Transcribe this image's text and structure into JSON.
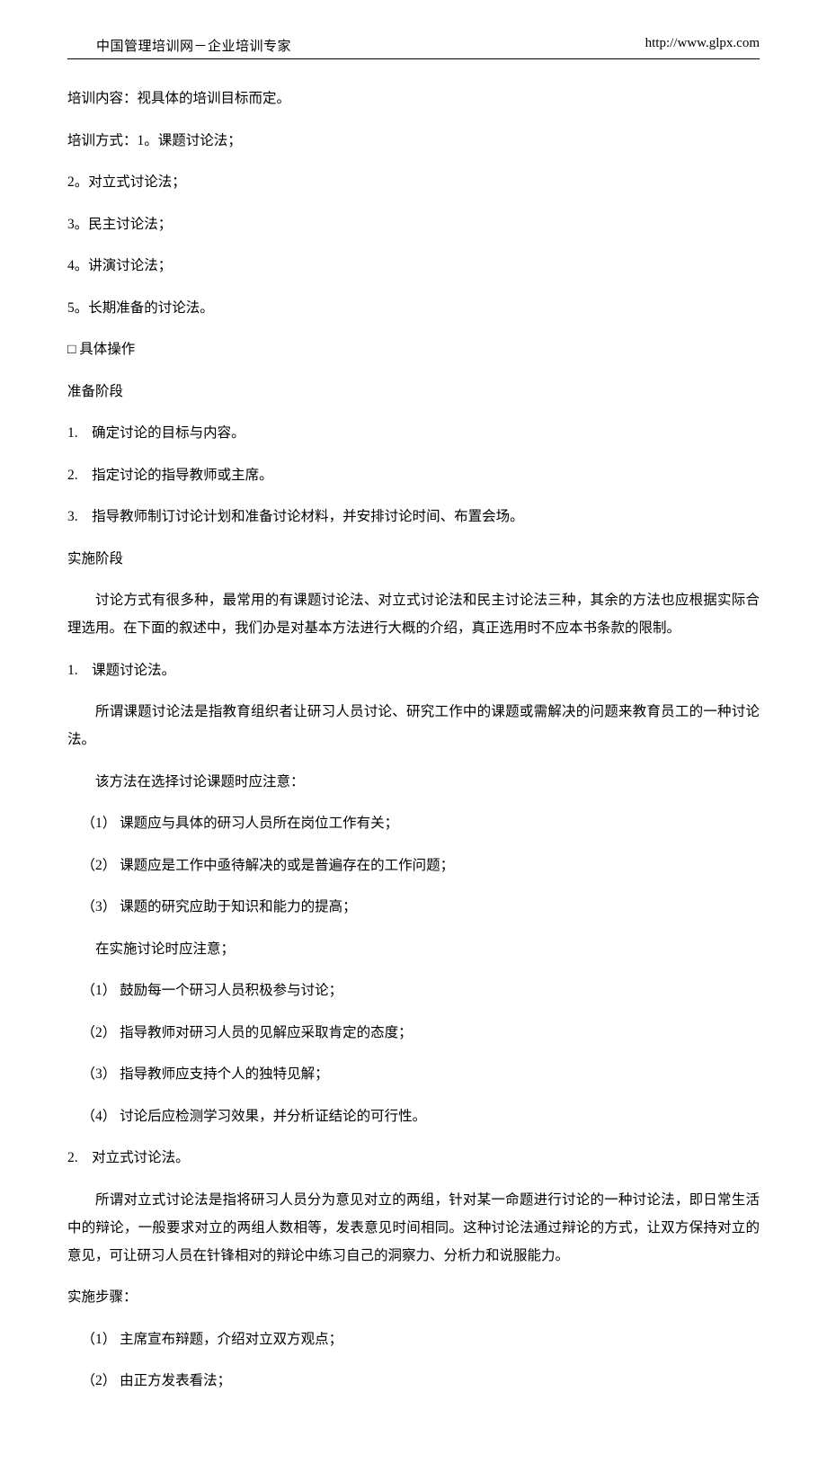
{
  "header": {
    "left": "中国管理培训网－企业培训专家",
    "right": "http://www.glpx.com"
  },
  "lines": {
    "l1": "培训内容：视具体的培训目标而定。",
    "l2": "培训方式：1。课题讨论法；",
    "l3": "2。对立式讨论法；",
    "l4": "3。民主讨论法；",
    "l5": "4。讲演讨论法；",
    "l6": "5。长期准备的讨论法。",
    "l7": "□ 具体操作",
    "l8": "准备阶段",
    "l9": "1.　确定讨论的目标与内容。",
    "l10": "2.　指定讨论的指导教师或主席。",
    "l11": "3.　指导教师制订讨论计划和准备讨论材料，并安排讨论时间、布置会场。",
    "l12": "实施阶段",
    "l13": "讨论方式有很多种，最常用的有课题讨论法、对立式讨论法和民主讨论法三种，其余的方法也应根据实际合理选用。在下面的叙述中，我们办是对基本方法进行大概的介绍，真正选用时不应本书条款的限制。",
    "l14": "1.　课题讨论法。",
    "l15": "所谓课题讨论法是指教育组织者让研习人员讨论、研究工作中的课题或需解决的问题来教育员工的一种讨论法。",
    "l16": "该方法在选择讨论课题时应注意：",
    "l17": "（1） 课题应与具体的研习人员所在岗位工作有关；",
    "l18": "（2） 课题应是工作中亟待解决的或是普遍存在的工作问题；",
    "l19": "（3） 课题的研究应助于知识和能力的提高；",
    "l20": "在实施讨论时应注意；",
    "l21": "（1） 鼓励每一个研习人员积极参与讨论；",
    "l22": "（2） 指导教师对研习人员的见解应采取肯定的态度；",
    "l23": "（3） 指导教师应支持个人的独特见解；",
    "l24": "（4） 讨论后应检测学习效果，并分析证结论的可行性。",
    "l25": "2.　对立式讨论法。",
    "l26": "所谓对立式讨论法是指将研习人员分为意见对立的两组，针对某一命题进行讨论的一种讨论法，即日常生活中的辩论，一般要求对立的两组人数相等，发表意见时间相同。这种讨论法通过辩论的方式，让双方保持对立的意见，可让研习人员在针锋相对的辩论中练习自己的洞察力、分析力和说服能力。",
    "l27": "实施步骤：",
    "l28": "（1） 主席宣布辩题，介绍对立双方观点；",
    "l29": "（2） 由正方发表看法；"
  }
}
